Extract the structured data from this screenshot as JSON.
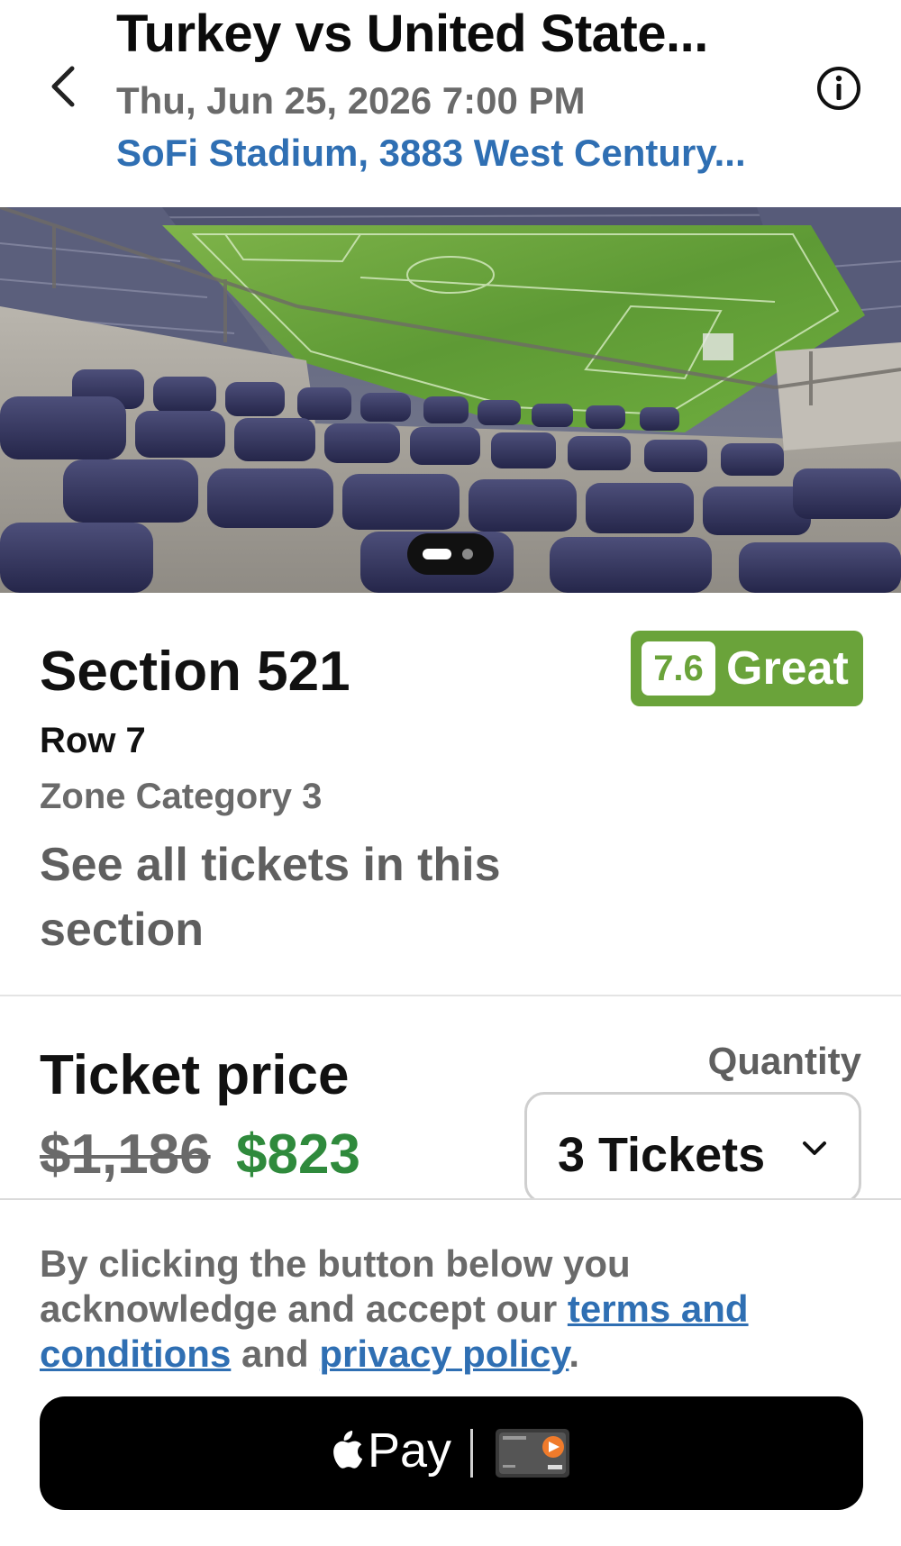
{
  "header": {
    "title": "Turkey vs United State...",
    "datetime": "Thu, Jun 25, 2026 7:00 PM",
    "venue": "SoFi Stadium, 3883 West Century..."
  },
  "icons": {
    "back": "chevron-left-icon",
    "info": "info-icon",
    "dropdown": "chevron-down-icon",
    "apple": "apple-logo-icon",
    "card": "card-icon"
  },
  "gallery": {
    "current_page": 1,
    "total_pages": 2
  },
  "section": {
    "title": "Section 521",
    "row": "Row 7",
    "zone": "Zone Category 3",
    "see_all": "See all tickets in this section",
    "rating_score": "7.6",
    "rating_text": "Great"
  },
  "price": {
    "title": "Ticket price",
    "original": "$1,186",
    "current": "$823",
    "quantity_label": "Quantity",
    "quantity_value": "3 Tickets"
  },
  "terms": {
    "prefix": "By clicking the button below you acknowledge and accept our",
    "terms_link": "terms and conditions",
    "middle": "and",
    "privacy_link": "privacy policy",
    "suffix": "."
  },
  "pay_button": {
    "label": "Pay"
  },
  "colors": {
    "accent_blue": "#2f6fb3",
    "rating_green": "#6aa33a",
    "price_green": "#2f8a3c",
    "muted_gray": "#6a6a6a"
  }
}
